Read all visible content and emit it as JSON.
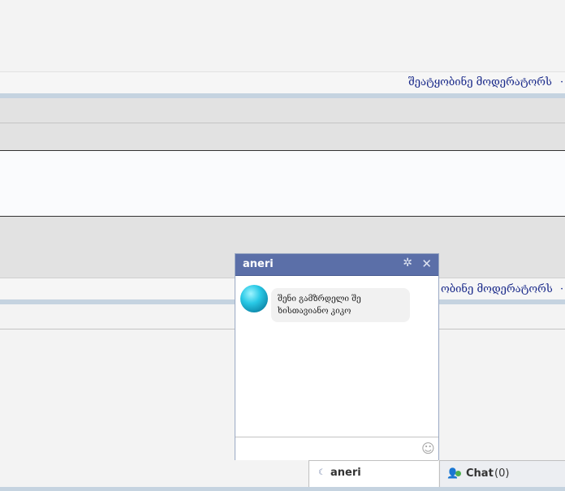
{
  "report_link": "შეატყობინე მოდერატორს",
  "report_link_partial": "ობინე მოდერატორს",
  "chat_window": {
    "title": "aneri",
    "settings_icon": "gear-icon",
    "close_icon": "close-icon",
    "message": "შენი გამზრდელი შე ხისთავიანო კიკო",
    "emoji_icon": "smiley-icon"
  },
  "chat_bar": {
    "tab_name": "aneri",
    "chat_label": "Chat",
    "chat_count": "(0)"
  },
  "colors": {
    "chat_header": "#5b6fa8",
    "online": "#4caf50",
    "link": "#1a2a8a"
  }
}
